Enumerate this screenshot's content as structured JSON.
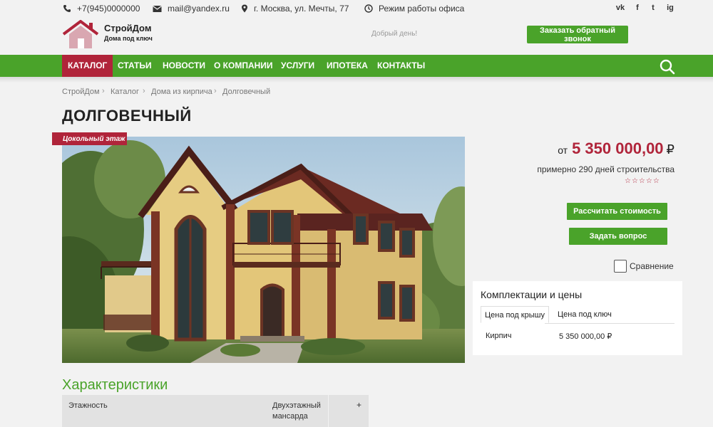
{
  "topbar": {
    "phone": "+7(945)0000000",
    "email": "mail@yandex.ru",
    "address": "г. Москва, ул. Мечты, 77",
    "hours": "Режим работы офиса",
    "social": [
      {
        "name": "vk-icon",
        "label": "vk"
      },
      {
        "name": "facebook-icon",
        "label": "f"
      },
      {
        "name": "twitter-icon",
        "label": "t"
      },
      {
        "name": "instagram-icon",
        "label": "ig"
      }
    ]
  },
  "header": {
    "logo_name": "СтройДом",
    "logo_tagline": "Дома под ключ",
    "greeting": "Добрый день!",
    "callback_label": "Заказать обратный звонок"
  },
  "nav": {
    "items": [
      "КАТАЛОГ",
      "СТАТЬИ",
      "НОВОСТИ",
      "О КОМПАНИИ",
      "УСЛУГИ",
      "ИПОТЕКА",
      "КОНТАКТЫ"
    ],
    "active_index": 0
  },
  "breadcrumb": [
    "СтройДом",
    "Каталог",
    "Дома из кирпича",
    "Долговечный"
  ],
  "page": {
    "title": "ДОЛГОВЕЧНЫЙ",
    "photo_badge": "Цокольный этаж"
  },
  "pricing": {
    "prefix": "от",
    "price": "5 350 000,00",
    "currency": "₽",
    "build_time": "примерно 290 дней строительства",
    "rating": "☆☆☆☆☆",
    "calc_button": "Рассчитать стоимость",
    "question_button": "Задать вопрос",
    "compare_label": "Сравнение"
  },
  "configurations": {
    "title": "Комплектации и цены",
    "tabs": [
      "Цена под крышу",
      "Цена под ключ"
    ],
    "active_tab": 0,
    "rows": [
      {
        "material": "Кирпич",
        "price": "5 350 000,00 ₽"
      }
    ]
  },
  "characteristics": {
    "title": "Характеристики",
    "rows": [
      {
        "name": "Этажность",
        "value": "Двухэтажный мансарда",
        "toggle": "+"
      }
    ]
  },
  "colors": {
    "green": "#4aa32a",
    "brand_red": "#b0243a",
    "background": "#f2f2f2"
  }
}
